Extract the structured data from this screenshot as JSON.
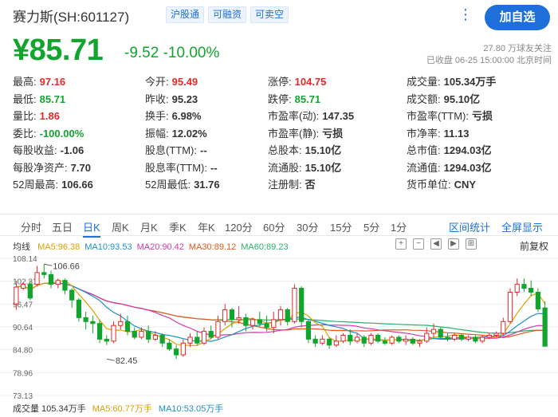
{
  "header": {
    "stock_name": "赛力斯(SH:601127)",
    "tags": [
      "沪股通",
      "可融资",
      "可卖空"
    ],
    "more_label": "⋮",
    "add_button": "加自选"
  },
  "quote": {
    "price": "¥85.71",
    "change": "-9.52 -10.00%",
    "followers": "27.80 万球友关注",
    "status": "已收盘 06-25 15:00:00 北京时间"
  },
  "stats": [
    {
      "label": "最高:",
      "value": "97.16",
      "color": "red"
    },
    {
      "label": "今开:",
      "value": "95.49",
      "color": "red"
    },
    {
      "label": "涨停:",
      "value": "104.75",
      "color": "red"
    },
    {
      "label": "成交量:",
      "value": "105.34万手",
      "color": "dark"
    },
    {
      "label": "最低:",
      "value": "85.71",
      "color": "green"
    },
    {
      "label": "昨收:",
      "value": "95.23",
      "color": "dark"
    },
    {
      "label": "跌停:",
      "value": "85.71",
      "color": "green"
    },
    {
      "label": "成交额:",
      "value": "95.10亿",
      "color": "dark"
    },
    {
      "label": "量比:",
      "value": "1.86",
      "color": "red"
    },
    {
      "label": "换手:",
      "value": "6.98%",
      "color": "dark"
    },
    {
      "label": "市盈率(动):",
      "value": "147.35",
      "color": "dark"
    },
    {
      "label": "市盈率(TTM):",
      "value": "亏损",
      "color": "dark"
    },
    {
      "label": "委比:",
      "value": "-100.00%",
      "color": "green"
    },
    {
      "label": "振幅:",
      "value": "12.02%",
      "color": "dark"
    },
    {
      "label": "市盈率(静):",
      "value": "亏损",
      "color": "dark"
    },
    {
      "label": "市净率:",
      "value": "11.13",
      "color": "dark"
    },
    {
      "label": "每股收益:",
      "value": "-1.06",
      "color": "dark"
    },
    {
      "label": "股息(TTM):",
      "value": "--",
      "color": "dark"
    },
    {
      "label": "总股本:",
      "value": "15.10亿",
      "color": "dark"
    },
    {
      "label": "总市值:",
      "value": "1294.03亿",
      "color": "dark"
    },
    {
      "label": "每股净资产:",
      "value": "7.70",
      "color": "dark"
    },
    {
      "label": "股息率(TTM):",
      "value": "--",
      "color": "dark"
    },
    {
      "label": "流通股:",
      "value": "15.10亿",
      "color": "dark"
    },
    {
      "label": "流通值:",
      "value": "1294.03亿",
      "color": "dark"
    },
    {
      "label": "52周最高:",
      "value": "106.66",
      "color": "dark"
    },
    {
      "label": "52周最低:",
      "value": "31.76",
      "color": "dark"
    },
    {
      "label": "注册制:",
      "value": "否",
      "color": "dark"
    },
    {
      "label": "货币单位:",
      "value": "CNY",
      "color": "dark"
    }
  ],
  "tabs": [
    "分时",
    "五日",
    "日K",
    "周K",
    "月K",
    "季K",
    "年K",
    "120分",
    "60分",
    "30分",
    "15分",
    "5分",
    "1分"
  ],
  "active_tab": "日K",
  "tab_links": [
    "区间统计",
    "全屏显示"
  ],
  "chart_toolbar": {
    "ma_title": "均线",
    "ma": [
      {
        "label": "MA5:96.38",
        "color": "#e0a000"
      },
      {
        "label": "MA10:93.53",
        "color": "#1e90c8"
      },
      {
        "label": "MA20:90.42",
        "color": "#d03aa8"
      },
      {
        "label": "MA30:89.12",
        "color": "#e05a1e"
      },
      {
        "label": "MA60:89.23",
        "color": "#2ab06a"
      }
    ],
    "icons": [
      "+",
      "−",
      "◀",
      "▶",
      "⊞"
    ],
    "fuquan": "前复权"
  },
  "chart_data": {
    "type": "candlestick",
    "y_ticks": [
      "108.14",
      "102.31",
      "96.47",
      "90.64",
      "84.80",
      "78.96",
      "73.13"
    ],
    "ylim": [
      73.13,
      108.14
    ],
    "annotations": [
      {
        "text": "106.66",
        "candle": 4,
        "value": 106.66
      },
      {
        "text": "82.45",
        "candle": 13,
        "value": 82.45
      }
    ],
    "candles": [
      [
        96.5,
        100.8,
        95.0,
        102.4
      ],
      [
        100.5,
        101.5,
        100.0,
        102.0
      ],
      [
        101.5,
        98.0,
        97.5,
        102.5
      ],
      [
        101.5,
        104.5,
        101.0,
        106.2
      ],
      [
        104.5,
        104.0,
        103.0,
        106.66
      ],
      [
        104.0,
        101.5,
        100.5,
        105.0
      ],
      [
        101.5,
        102.5,
        100.5,
        103.0
      ],
      [
        102.5,
        100.0,
        99.0,
        103.0
      ],
      [
        100.0,
        97.5,
        95.5,
        100.5
      ],
      [
        97.5,
        93.0,
        92.0,
        98.0
      ],
      [
        93.0,
        92.0,
        90.0,
        94.5
      ],
      [
        92.0,
        91.5,
        89.0,
        93.5
      ],
      [
        91.5,
        87.5,
        86.5,
        92.5
      ],
      [
        87.5,
        87.0,
        86.0,
        88.5
      ],
      [
        87.0,
        91.0,
        86.5,
        92.0
      ],
      [
        91.0,
        92.0,
        90.0,
        94.0
      ],
      [
        92.0,
        89.5,
        88.5,
        93.5
      ],
      [
        89.5,
        88.0,
        87.5,
        90.5
      ],
      [
        88.0,
        89.5,
        87.5,
        90.5
      ],
      [
        89.5,
        87.5,
        86.5,
        91.0
      ],
      [
        87.5,
        88.5,
        87.0,
        89.5
      ],
      [
        88.5,
        86.5,
        85.5,
        89.0
      ],
      [
        86.5,
        85.0,
        84.5,
        87.5
      ],
      [
        85.0,
        83.5,
        82.45,
        86.0
      ],
      [
        83.5,
        86.5,
        83.0,
        87.5
      ],
      [
        86.5,
        88.0,
        85.5,
        89.0
      ],
      [
        88.0,
        86.5,
        86.0,
        89.5
      ],
      [
        86.5,
        89.5,
        86.0,
        90.5
      ],
      [
        89.5,
        88.0,
        87.5,
        91.0
      ],
      [
        88.0,
        92.0,
        87.5,
        93.5
      ],
      [
        92.0,
        95.0,
        91.0,
        96.5
      ],
      [
        95.0,
        92.5,
        90.5,
        95.5
      ],
      [
        92.5,
        93.0,
        91.5,
        96.0
      ],
      [
        93.0,
        91.0,
        89.5,
        94.0
      ],
      [
        91.0,
        92.5,
        90.0,
        93.0
      ],
      [
        92.5,
        91.5,
        90.5,
        94.5
      ],
      [
        91.5,
        90.5,
        89.5,
        93.5
      ],
      [
        90.5,
        92.5,
        89.0,
        94.5
      ],
      [
        92.5,
        95.0,
        91.0,
        96.0
      ],
      [
        95.0,
        92.0,
        91.0,
        95.5
      ],
      [
        92.0,
        100.5,
        91.5,
        101.5
      ],
      [
        100.5,
        92.0,
        90.5,
        101.0
      ],
      [
        92.0,
        87.5,
        86.5,
        92.5
      ],
      [
        87.5,
        86.5,
        85.5,
        88.5
      ],
      [
        86.5,
        87.5,
        86.0,
        88.5
      ],
      [
        87.5,
        86.0,
        85.0,
        88.0
      ],
      [
        86.0,
        87.0,
        85.5,
        88.5
      ],
      [
        87.0,
        88.5,
        86.5,
        89.0
      ],
      [
        88.5,
        87.0,
        86.0,
        90.0
      ],
      [
        87.0,
        88.0,
        86.5,
        89.0
      ],
      [
        88.0,
        86.5,
        85.5,
        88.5
      ],
      [
        86.5,
        88.5,
        86.0,
        89.0
      ],
      [
        88.5,
        87.0,
        86.5,
        89.0
      ],
      [
        87.0,
        86.5,
        86.0,
        88.0
      ],
      [
        86.5,
        88.0,
        86.0,
        88.5
      ],
      [
        88.0,
        87.0,
        86.5,
        88.5
      ],
      [
        87.0,
        87.5,
        86.0,
        88.5
      ],
      [
        87.5,
        86.5,
        86.0,
        88.0
      ],
      [
        86.5,
        87.0,
        85.5,
        87.5
      ],
      [
        87.0,
        89.0,
        86.5,
        90.5
      ],
      [
        89.0,
        90.0,
        88.0,
        91.5
      ],
      [
        90.0,
        88.0,
        87.5,
        90.5
      ],
      [
        88.0,
        87.5,
        87.0,
        89.0
      ],
      [
        87.5,
        88.5,
        87.0,
        89.0
      ],
      [
        88.5,
        87.5,
        87.0,
        89.0
      ],
      [
        87.5,
        88.0,
        87.0,
        88.5
      ],
      [
        88.0,
        87.0,
        86.5,
        88.5
      ],
      [
        87.0,
        88.0,
        86.5,
        88.5
      ],
      [
        88.0,
        88.5,
        87.5,
        89.0
      ],
      [
        88.5,
        89.0,
        88.0,
        89.5
      ],
      [
        89.0,
        92.0,
        88.5,
        93.0
      ],
      [
        92.0,
        99.5,
        91.5,
        100.5
      ],
      [
        99.5,
        101.5,
        98.5,
        103.0
      ],
      [
        101.5,
        100.5,
        99.5,
        103.0
      ],
      [
        100.5,
        99.5,
        98.5,
        102.5
      ],
      [
        99.5,
        95.23,
        94.5,
        100.5
      ],
      [
        95.49,
        85.71,
        85.71,
        97.16
      ]
    ]
  },
  "bottom_bar": [
    {
      "label": "成交量 105.34万手",
      "color": "#333333"
    },
    {
      "label": "MA5:60.77万手",
      "color": "#e0a000"
    },
    {
      "label": "MA10:53.05万手",
      "color": "#1e90c8"
    }
  ],
  "colors": {
    "up": "#e4292a",
    "down": "#11a52d",
    "accent": "#1e6fd9"
  }
}
